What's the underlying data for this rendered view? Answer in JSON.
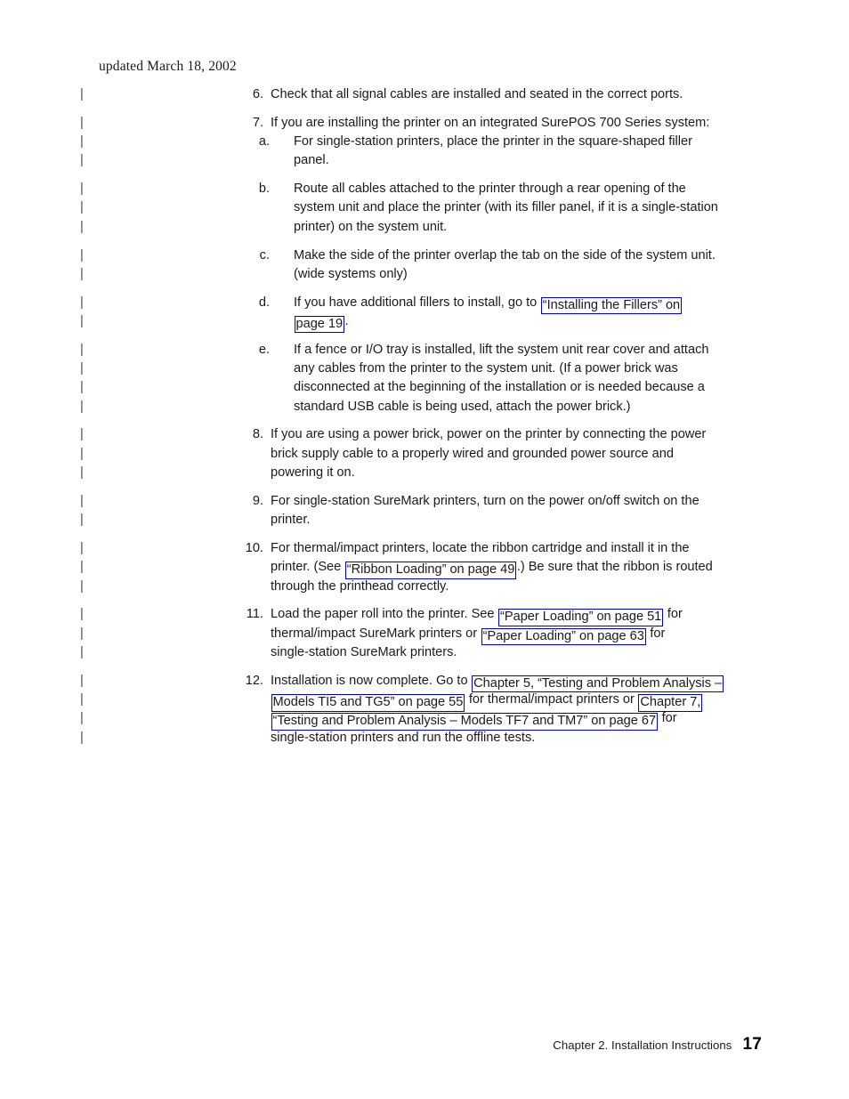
{
  "header": {
    "revision_note": "updated March 18, 2002"
  },
  "change_bar": {
    "glyph": "|"
  },
  "footer": {
    "chapter_text": "Chapter 2. Installation Instructions",
    "page_number": "17"
  },
  "colors": {
    "link_border": "#0000cc",
    "text": "#1a1a1a",
    "change_bar": "#4d4d4d",
    "page_background": "#ffffff"
  },
  "content": {
    "list_items": [
      {
        "marker": "6.",
        "level": 1,
        "text": "Check that all signal cables are installed and seated in the correct ports.",
        "lines": [
          {
            "text": "Check that all signal cables are installed and seated in the correct ports."
          }
        ]
      },
      {
        "marker": "7.",
        "level": 1,
        "text": "If you are installing the printer on an integrated SurePOS 700 Series system:",
        "lines": [
          {
            "text": "If you are installing the printer on an integrated SurePOS 700 Series system:"
          }
        ]
      },
      {
        "marker": "a.",
        "level": 2,
        "text": "For single-station printers, place the printer in the square-shaped filler panel.",
        "lines": [
          {
            "text": "For single-station printers, place the printer in the square-shaped filler"
          },
          {
            "text": "panel."
          }
        ]
      },
      {
        "marker": "b.",
        "level": 2,
        "text": "Route all cables attached to the printer through a rear opening of the system unit and place the printer (with its filler panel, if it is a single-station printer) on the system unit.",
        "lines": [
          {
            "text": "Route all cables attached to the printer through a rear opening of the"
          },
          {
            "text": "system unit and place the printer (with its filler panel, if it is a single-station"
          },
          {
            "text": "printer) on the system unit."
          }
        ]
      },
      {
        "marker": "c.",
        "level": 2,
        "text": "Make the side of the printer overlap the tab on the side of the system unit. (wide systems only)",
        "lines": [
          {
            "text": "Make the side of the printer overlap the tab on the side of the system unit."
          },
          {
            "text": "(wide systems only)"
          }
        ]
      },
      {
        "marker": "d.",
        "level": 2,
        "text": "If you have additional fillers to install, go to “Installing the Fillers” on page 19.",
        "lines": [
          {
            "segments": [
              {
                "type": "text",
                "text": "If you have additional fillers to install, go to "
              },
              {
                "type": "link",
                "text": "“Installing the Fillers” on"
              }
            ]
          },
          {
            "segments": [
              {
                "type": "link",
                "text": "page 19"
              },
              {
                "type": "text",
                "text": "."
              }
            ]
          }
        ]
      },
      {
        "marker": "e.",
        "level": 2,
        "text": "If a fence or I/O tray is installed, lift the system unit rear cover and attach any cables from the printer to the system unit. (If a power brick was disconnected at the beginning of the installation or is needed because a standard USB cable is being used, attach the power brick.)",
        "lines": [
          {
            "text": "If a fence or I/O tray is installed, lift the system unit rear cover and attach"
          },
          {
            "text": "any cables from the printer to the system unit. (If a power brick was"
          },
          {
            "text": "disconnected at the beginning of the installation or is needed because a"
          },
          {
            "text": "standard USB cable is being used, attach the power brick.)"
          }
        ]
      },
      {
        "marker": "8.",
        "level": 1,
        "text": "If you are using a power brick, power on the printer by connecting the power brick supply cable to a properly wired and grounded power source and powering it on.",
        "lines": [
          {
            "text": "If you are using a power brick, power on the printer by connecting the power"
          },
          {
            "text": "brick supply cable to a properly wired and grounded power source and"
          },
          {
            "text": "powering it on."
          }
        ]
      },
      {
        "marker": "9.",
        "level": 1,
        "text": "For single-station SureMark printers, turn on the power on/off switch on the printer.",
        "lines": [
          {
            "text": "For single-station SureMark printers, turn on the power on/off switch on the"
          },
          {
            "text": "printer."
          }
        ]
      },
      {
        "marker": "10.",
        "level": 1,
        "text": "For thermal/impact printers, locate the ribbon cartridge and install it in the printer. (See “Ribbon Loading” on page 49.) Be sure that the ribbon is routed through the printhead correctly.",
        "lines": [
          {
            "text": "For thermal/impact printers, locate the ribbon cartridge and install it in the"
          },
          {
            "segments": [
              {
                "type": "text",
                "text": "printer. (See "
              },
              {
                "type": "link",
                "text": "“Ribbon Loading” on page 49"
              },
              {
                "type": "text",
                "text": ".) Be sure that the ribbon is routed"
              }
            ]
          },
          {
            "text": "through the printhead correctly."
          }
        ]
      },
      {
        "marker": "11.",
        "level": 1,
        "text": "Load the paper roll into the printer. See “Paper Loading” on page 51 for thermal/impact SureMark printers or “Paper Loading” on page 63 for single-station SureMark printers.",
        "lines": [
          {
            "segments": [
              {
                "type": "text",
                "text": "Load the paper roll into the printer. See "
              },
              {
                "type": "link",
                "text": "“Paper Loading” on page 51"
              },
              {
                "type": "text",
                "text": " for"
              }
            ]
          },
          {
            "segments": [
              {
                "type": "text",
                "text": "thermal/impact SureMark printers or "
              },
              {
                "type": "link",
                "text": "“Paper Loading” on page 63"
              },
              {
                "type": "text",
                "text": " for"
              }
            ]
          },
          {
            "text": "single-station SureMark printers."
          }
        ]
      },
      {
        "marker": "12.",
        "level": 1,
        "text": "Installation is now complete. Go to Chapter 5, “Testing and Problem Analysis – Models TI5 and TG5” on page 55 for thermal/impact printers or Chapter 7, “Testing and Problem Analysis – Models TF7 and TM7” on page 67 for single-station printers and run the offline tests.",
        "lines": [
          {
            "segments": [
              {
                "type": "text",
                "text": "Installation is now complete. Go to "
              },
              {
                "type": "link",
                "text": "Chapter 5, “Testing and Problem Analysis –"
              }
            ]
          },
          {
            "segments": [
              {
                "type": "link",
                "text": "Models TI5 and TG5” on page 55"
              },
              {
                "type": "text",
                "text": " for thermal/impact printers or "
              },
              {
                "type": "link",
                "text": "Chapter 7,"
              }
            ]
          },
          {
            "segments": [
              {
                "type": "link",
                "text": "“Testing and Problem Analysis – Models TF7 and TM7” on page 67"
              },
              {
                "type": "text",
                "text": " for"
              }
            ]
          },
          {
            "text": "single-station printers and run the offline tests."
          }
        ]
      }
    ]
  }
}
